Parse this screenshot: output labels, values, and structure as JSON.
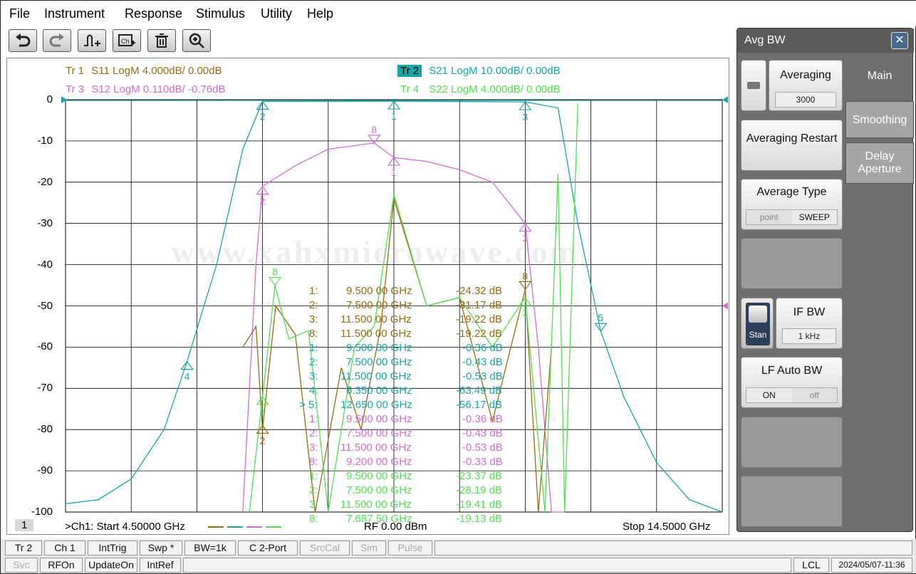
{
  "menu": [
    "File",
    "Instrument",
    "Response",
    "Stimulus",
    "Utility",
    "Help"
  ],
  "toolbar": [
    "undo-icon",
    "redo-icon",
    "add-marker-icon",
    "channel-preset-icon",
    "delete-icon",
    "zoom-icon"
  ],
  "traces": [
    {
      "id": "Tr 1",
      "text": "S11 LogM 4.000dB/  0.00dB",
      "color": "#9a6a10"
    },
    {
      "id": "Tr 2",
      "text": "S21 LogM 10.00dB/  0.00dB",
      "color": "#17a6a6",
      "active": true
    },
    {
      "id": "Tr 3",
      "text": "S12 LogM 0.110dB/  -0.76dB",
      "color": "#d46ad6"
    },
    {
      "id": "Tr 4",
      "text": "S22 LogM 4.000dB/  0.00dB",
      "color": "#4fe04f"
    }
  ],
  "yaxis": [
    "0",
    "-10",
    "-20",
    "-30",
    "-40",
    "-50",
    "-60",
    "-70",
    "-80",
    "-90",
    "-100"
  ],
  "watermark": "www.xahxmicrowave.com",
  "markers": [
    {
      "n": "1:",
      "f": "9.500 00 GHz",
      "v": "-24.32 dB",
      "c": "#9a6a10"
    },
    {
      "n": "2:",
      "f": "7.500 00 GHz",
      "v": "-31.17 dB",
      "c": "#9a6a10"
    },
    {
      "n": "3:",
      "f": "11.500 00 GHz",
      "v": "-19.22 dB",
      "c": "#9a6a10"
    },
    {
      "n": "8:",
      "f": "11.500 00 GHz",
      "v": "-19.22 dB",
      "c": "#9a6a10"
    },
    {
      "n": "1:",
      "f": "9.500 00 GHz",
      "v": "-0.36 dB",
      "c": "#17a6a6"
    },
    {
      "n": "2:",
      "f": "7.500 00 GHz",
      "v": "-0.43 dB",
      "c": "#17a6a6"
    },
    {
      "n": "3:",
      "f": "11.500 00 GHz",
      "v": "-0.53 dB",
      "c": "#17a6a6"
    },
    {
      "n": "4:",
      "f": "6.350 00 GHz",
      "v": "-63.49 dB",
      "c": "#17a6a6"
    },
    {
      "n": "> 5:",
      "f": "12.650 00 GHz",
      "v": "-56.17 dB",
      "c": "#17a6a6"
    },
    {
      "n": "1:",
      "f": "9.500 00 GHz",
      "v": "-0.36 dB",
      "c": "#d46ad6"
    },
    {
      "n": "2:",
      "f": "7.500 00 GHz",
      "v": "-0.43 dB",
      "c": "#d46ad6"
    },
    {
      "n": "3:",
      "f": "11.500 00 GHz",
      "v": "-0.53 dB",
      "c": "#d46ad6"
    },
    {
      "n": "8:",
      "f": "9.200 00 GHz",
      "v": "-0.33 dB",
      "c": "#d46ad6"
    },
    {
      "n": "1:",
      "f": "9.500 00 GHz",
      "v": "-23.37 dB",
      "c": "#4fe04f"
    },
    {
      "n": "2:",
      "f": "7.500 00 GHz",
      "v": "-28.19 dB",
      "c": "#4fe04f"
    },
    {
      "n": "3:",
      "f": "11.500 00 GHz",
      "v": "-19.41 dB",
      "c": "#4fe04f"
    },
    {
      "n": "8:",
      "f": "7.687 50 GHz",
      "v": "-19.13 dB",
      "c": "#4fe04f"
    }
  ],
  "status": {
    "channel": "1",
    "start": ">Ch1:  Start  4.50000 GHz",
    "rf": "RF    0.00 dBm",
    "stop": "Stop  14.5000 GHz"
  },
  "side": {
    "title": "Avg BW",
    "close": "✕",
    "tabs": [
      "Main",
      "Smoothing",
      "Delay Aperture"
    ],
    "averaging": {
      "label": "Averaging",
      "value": "3000"
    },
    "restart": "Averaging Restart",
    "avg_type": {
      "label": "Average Type",
      "options": [
        "point",
        "SWEEP"
      ]
    },
    "ifbw": {
      "label": "IF BW",
      "value": "1 kHz",
      "stan": "Stan"
    },
    "lfauto": {
      "label": "LF Auto BW",
      "options": [
        "ON",
        "off"
      ]
    }
  },
  "bottom1": [
    {
      "t": "Tr 2",
      "en": true
    },
    {
      "t": "Ch 1",
      "en": true
    },
    {
      "t": "IntTrig",
      "en": true
    },
    {
      "t": "Swp *",
      "en": true
    },
    {
      "t": "BW=1k",
      "en": true
    },
    {
      "t": "C  2-Port",
      "en": true
    },
    {
      "t": "SrcCal",
      "en": false
    },
    {
      "t": "Sim",
      "en": false
    },
    {
      "t": "Pulse",
      "en": false
    }
  ],
  "bottom2": [
    {
      "t": "Svc",
      "en": false
    },
    {
      "t": "RFOn",
      "en": true
    },
    {
      "t": "UpdateOn",
      "en": true
    },
    {
      "t": "IntRef",
      "en": true
    }
  ],
  "lcl": "LCL",
  "datetime": "2024/05/07-11:36",
  "chart_data": {
    "type": "line",
    "xlim": [
      4.5,
      14.5
    ],
    "ylim": [
      -100,
      0
    ],
    "series": [
      {
        "name": "S21",
        "x": [
          4.5,
          5.0,
          5.5,
          6.0,
          6.35,
          6.8,
          7.2,
          7.5,
          9.5,
          11.5,
          12.0,
          12.3,
          12.65,
          13.0,
          13.5,
          14.0,
          14.5
        ],
        "y": [
          -98,
          -97,
          -92,
          -80,
          -63.49,
          -40,
          -12,
          -0.43,
          -0.36,
          -0.53,
          -2,
          -30,
          -56.17,
          -72,
          -88,
          -97,
          -100
        ]
      },
      {
        "name": "S12",
        "x": [
          7.2,
          7.4,
          7.5,
          7.7,
          8.0,
          8.5,
          9.2,
          9.5,
          10.0,
          10.5,
          11.0,
          11.5,
          11.7,
          11.9,
          12.1
        ],
        "y": [
          -100,
          -40,
          -21,
          -19,
          -16,
          -12,
          -10.5,
          -14,
          -15,
          -17,
          -20,
          -30,
          -60,
          -100,
          -100
        ]
      },
      {
        "name": "S11",
        "x": [
          7.2,
          7.4,
          7.5,
          7.7,
          8.0,
          8.3,
          8.7,
          9.0,
          9.3,
          9.5,
          10.0,
          10.5,
          11.0,
          11.5,
          11.7,
          11.9
        ],
        "y": [
          -60,
          -55,
          -80,
          -50,
          -57,
          -100,
          -65,
          -80,
          -55,
          -24,
          -50,
          -48,
          -78,
          -46,
          -100,
          -60
        ]
      },
      {
        "name": "S22",
        "x": [
          7.3,
          7.5,
          7.69,
          7.9,
          8.2,
          8.5,
          8.9,
          9.2,
          9.5,
          10.0,
          10.5,
          11.0,
          11.5,
          11.8,
          12.0,
          12.1,
          12.3
        ],
        "y": [
          -100,
          -72,
          -45,
          -58,
          -56,
          -100,
          -60,
          -55,
          -23,
          -50,
          -48,
          -60,
          -48,
          -100,
          -18,
          -100,
          -1
        ]
      }
    ]
  }
}
